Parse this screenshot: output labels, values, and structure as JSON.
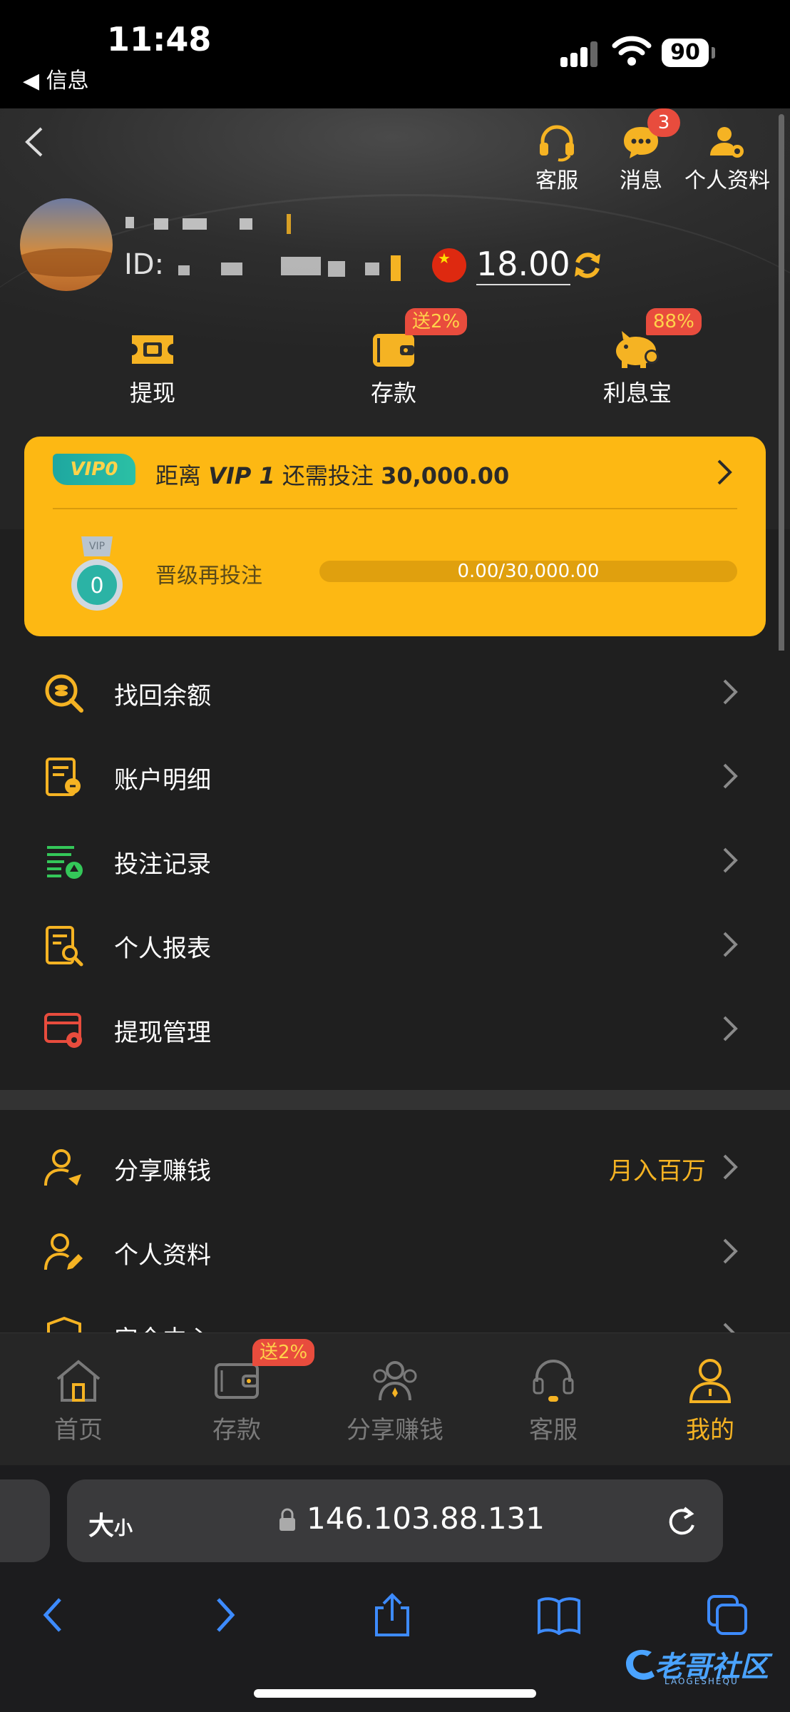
{
  "status_bar": {
    "time": "11:48",
    "back_app": "◀ 信息",
    "battery": "90"
  },
  "header": {
    "actions": [
      {
        "label": "客服",
        "icon": "headset-icon"
      },
      {
        "label": "消息",
        "icon": "chat-bubble-icon",
        "badge": "3"
      },
      {
        "label": "个人资料",
        "icon": "user-gear-icon"
      }
    ],
    "id_label": "ID:",
    "balance": "18.00",
    "currency_icon": "china-flag-icon"
  },
  "quick_actions": [
    {
      "label": "提现",
      "icon": "cash-ticket-icon"
    },
    {
      "label": "存款",
      "icon": "wallet-icon",
      "badge": "送2%"
    },
    {
      "label": "利息宝",
      "icon": "piggy-bank-icon",
      "badge": "88%"
    }
  ],
  "vip": {
    "tag": "VIP0",
    "prefix": "距离",
    "next_level": "VIP 1",
    "middle": "还需投注",
    "amount": "30,000.00",
    "medal_level": "0",
    "medal_ribbon": "VIP",
    "upgrade_label": "晋级再投注",
    "progress_text": "0.00/30,000.00",
    "progress_fraction": 0
  },
  "menu_primary": [
    {
      "label": "找回余额",
      "icon": "coin-search-icon"
    },
    {
      "label": "账户明细",
      "icon": "account-detail-icon"
    },
    {
      "label": "投注记录",
      "icon": "bet-record-icon"
    },
    {
      "label": "个人报表",
      "icon": "report-search-icon"
    },
    {
      "label": "提现管理",
      "icon": "withdraw-manage-icon"
    }
  ],
  "menu_secondary": [
    {
      "label": "分享赚钱",
      "icon": "share-user-icon",
      "extra": "月入百万"
    },
    {
      "label": "个人资料",
      "icon": "user-edit-icon"
    },
    {
      "label": "安全中心",
      "icon": "shield-icon"
    }
  ],
  "tabbar": {
    "items": [
      {
        "label": "首页",
        "icon": "home-icon"
      },
      {
        "label": "存款",
        "icon": "wallet-icon",
        "badge": "送2%"
      },
      {
        "label": "分享赚钱",
        "icon": "team-icon"
      },
      {
        "label": "客服",
        "icon": "headset-icon"
      },
      {
        "label": "我的",
        "icon": "person-icon",
        "active": true
      }
    ]
  },
  "safari": {
    "text_size": "大",
    "text_size_small": "小",
    "url": "146.103.88.131"
  },
  "watermark": {
    "text": "老哥社区",
    "sub": "LAOGESHEQU"
  },
  "colors": {
    "accent": "#f5b323",
    "vip_card": "#fdb813",
    "badge": "#e84c3d",
    "background": "#1f1f1f"
  }
}
